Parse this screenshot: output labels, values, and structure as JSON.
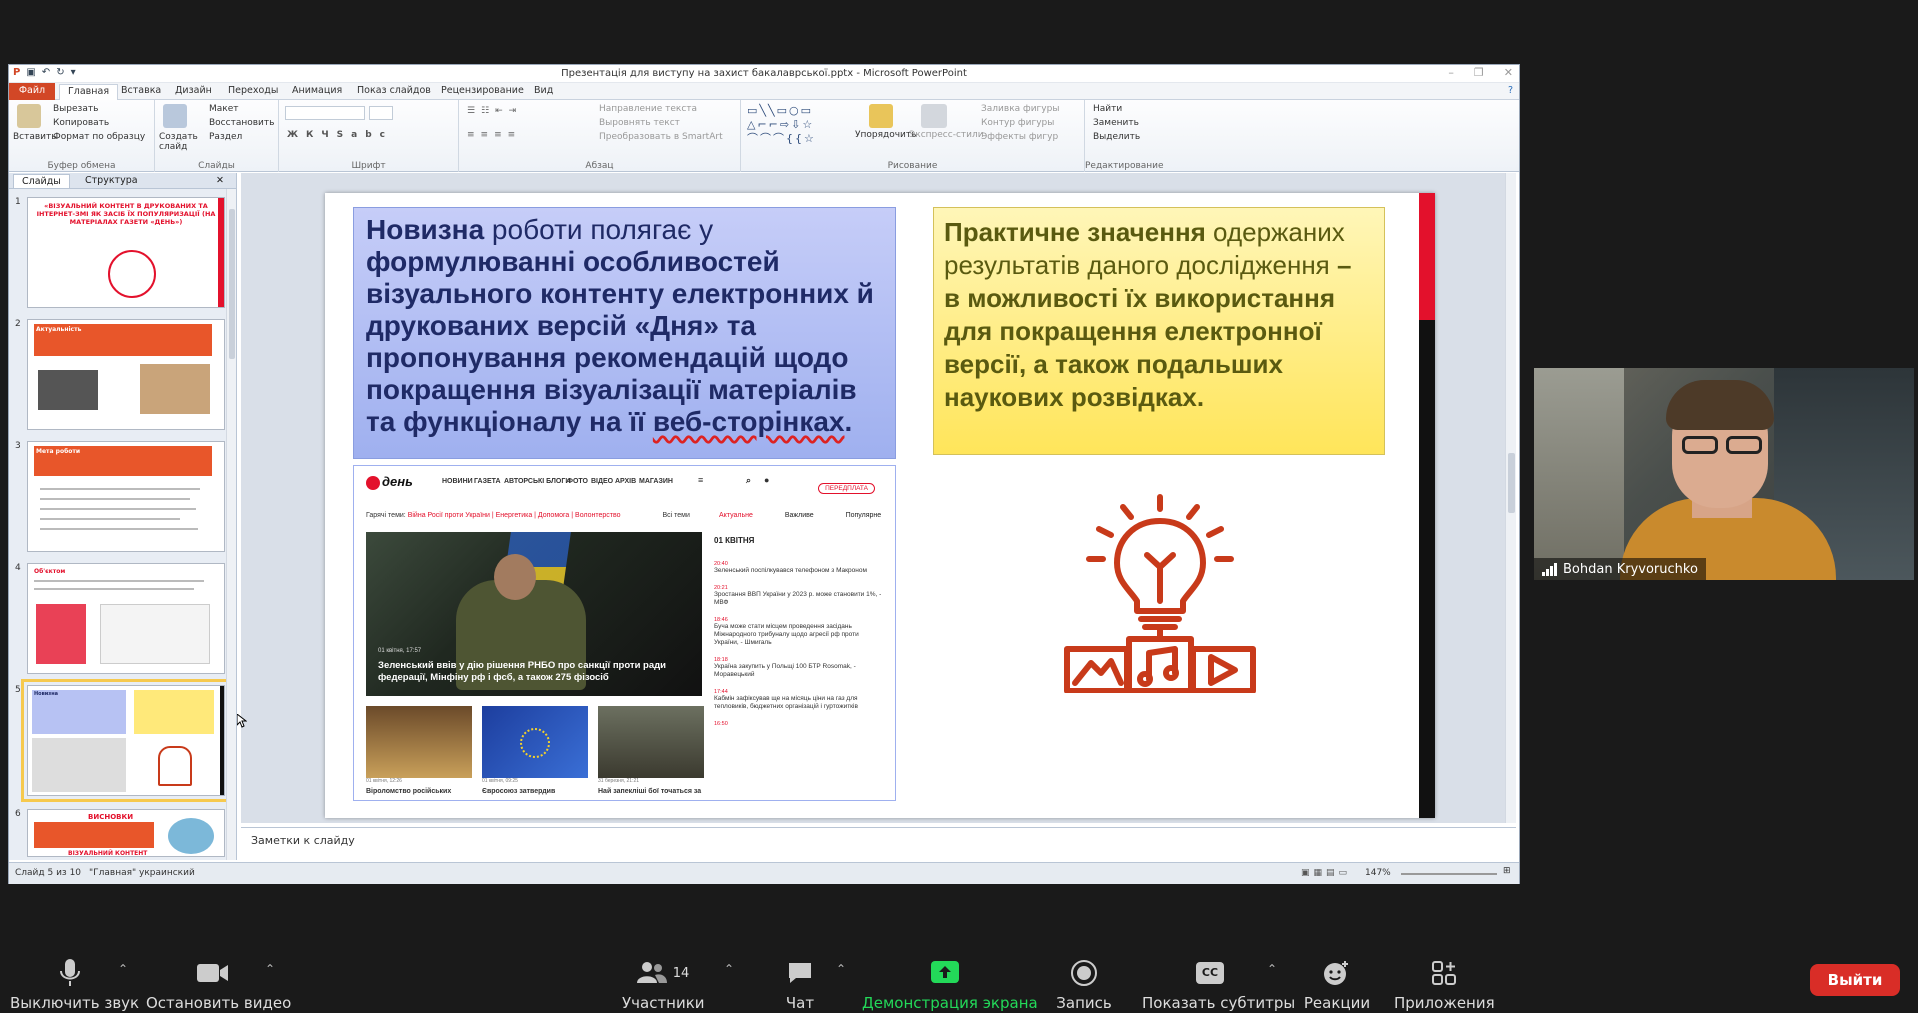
{
  "ppt": {
    "title": "Презентація для виступу на захист бакалаврської.pptx - Microsoft PowerPoint",
    "tabs": [
      "Файл",
      "Главная",
      "Вставка",
      "Дизайн",
      "Переходы",
      "Анимация",
      "Показ слайдов",
      "Рецензирование",
      "Вид"
    ],
    "ribbon": {
      "clipboard": {
        "paste": "Вставить",
        "cut": "Вырезать",
        "copy": "Копировать",
        "format": "Формат по образцу",
        "label": "Буфер обмена"
      },
      "slides": {
        "create": "Создать слайд",
        "layout": "Макет",
        "reset": "Восстановить",
        "section": "Раздел",
        "label": "Слайды"
      },
      "font": {
        "label": "Шрифт"
      },
      "paragraph": {
        "direction": "Направление текста",
        "align": "Выровнять текст",
        "smartart": "Преобразовать в SmartArt",
        "label": "Абзац"
      },
      "drawing": {
        "arrange": "Упорядочить",
        "styles": "Экспресс-стили",
        "fill": "Заливка фигуры",
        "outline": "Контур фигуры",
        "effects": "Эффекты фигур",
        "label": "Рисование"
      },
      "editing": {
        "find": "Найти",
        "replace": "Заменить",
        "select": "Выделить",
        "label": "Редактирование"
      }
    },
    "panel_tabs": [
      "Слайды",
      "Структура"
    ],
    "thumbs": [
      {
        "num": "1",
        "title": "«ВІЗУАЛЬНИЙ КОНТЕНТ В ДРУКОВАНИХ ТА ІНТЕРНЕТ-ЗМІ ЯК ЗАСІБ ЇХ ПОПУЛЯРИЗАЦІЇ (НА МАТЕРІАЛАХ ГАЗЕТИ «ДЕНЬ»)"
      },
      {
        "num": "2",
        "title": "Актуальність"
      },
      {
        "num": "3",
        "title": "Мета роботи"
      },
      {
        "num": "4",
        "title": "Об'єктом"
      },
      {
        "num": "5",
        "title": "Новизна"
      },
      {
        "num": "6",
        "title": "ВИСНОВКИ"
      }
    ],
    "thumb6_sub": "ВІЗУАЛЬНИЙ КОНТЕНТ",
    "notes_placeholder": "Заметки к слайду",
    "status": {
      "slide": "Слайд 5 из 10",
      "theme": "\"Главная\"",
      "lang": "украинский",
      "zoom": "147%"
    }
  },
  "slide": {
    "nov_lead": "Новизна",
    "nov_text1": " роботи полягає у ",
    "nov_text2": "формулюванні особливостей візуального контенту електронних й друкованих версій «Дня» та пропонування рекомендацій щодо покращення візуалізації матеріалів та функціоналу на її ",
    "nov_link": "веб-сторінках",
    "nov_end": ".",
    "prac_lead": "Практичне значення",
    "prac_text1": " одержаних результатів даного дослідження ",
    "prac_text2": "– в можливості їх використання для покращення електронної версії, а також подальших наукових розвідках."
  },
  "news": {
    "logo": "день",
    "nav": [
      "НОВИНИ",
      "ГАЗЕТА",
      "АВТОРСЬКІ БЛОГИ",
      "ФОТО",
      "ВІДЕО",
      "АРХІВ",
      "МАГАЗИН"
    ],
    "subscribe": "ПЕРЕДПЛАТА",
    "hot_label": "Гарячі теми:",
    "hot_topics": "Війна Росії проти України | Енергетика | Допомога | Волонтерство",
    "all_topics": "Всі теми",
    "tabs": [
      "Актуальне",
      "Важливе",
      "Популярне"
    ],
    "main_date": "01 квітня, 17:57",
    "main_caption": "Зеленський ввів у дію рішення РНБО про санкції проти ради федерації, Мінфіну рф і фсб, а також 275 фізосіб",
    "small": [
      {
        "date": "01 квітня, 12:26",
        "caption": "Віроломство російських"
      },
      {
        "date": "01 квітня, 09:25",
        "caption": "Євросоюз затвердив"
      },
      {
        "date": "31 березня, 21:21",
        "caption": "Най запекліші бої точаться за"
      }
    ],
    "feed_date": "01 КВІТНЯ",
    "feed": [
      {
        "time": "20:40",
        "text": "Зеленський поспілкувався телефоном з Макроном"
      },
      {
        "time": "20:21",
        "text": "Зростання ВВП України у 2023 р. може становити 1%, - МВФ"
      },
      {
        "time": "18:46",
        "text": "Буча може стати місцем проведення засідань Міжнародного трибуналу щодо агресії рф проти України, - Шмигаль"
      },
      {
        "time": "18:18",
        "text": "Україна закупить у Польщі 100 БТР Rosomak, - Моравецький"
      },
      {
        "time": "17:44",
        "text": "Кабмін зафіксував ще на місяць ціни на газ для тепловиків, бюджетних організацій і гуртожитків"
      },
      {
        "time": "16:50",
        "text": ""
      }
    ]
  },
  "webcam": {
    "name": "Bohdan Kryvoruchko"
  },
  "zoom": {
    "mute": "Выключить звук",
    "video": "Остановить видео",
    "participants": "Участники",
    "participants_count": "14",
    "chat": "Чат",
    "share": "Демонстрация экрана",
    "record": "Запись",
    "cc": "Показать субтитры",
    "reactions": "Реакции",
    "apps": "Приложения",
    "leave": "Выйти"
  },
  "colors": {
    "accent_red": "#e3112c",
    "share_green": "#23d959",
    "leave_red": "#d92d27",
    "file_tab": "#d24726"
  }
}
